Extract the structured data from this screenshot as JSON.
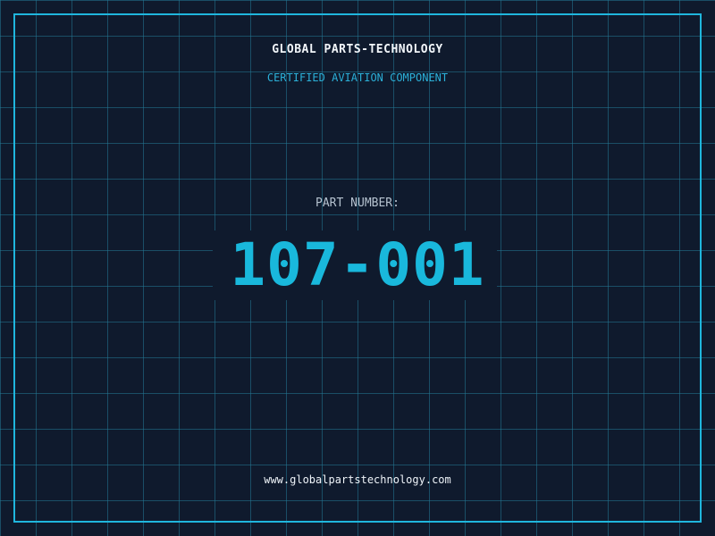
{
  "header": {
    "brand": "GLOBAL PARTS-TECHNOLOGY",
    "tagline": "CERTIFIED AVIATION COMPONENT"
  },
  "part": {
    "label": "PART NUMBER:",
    "number": "107-001"
  },
  "footer": {
    "website": "www.globalpartstechnology.com"
  },
  "colors": {
    "background": "#0f1a2d",
    "grid": "#23789a",
    "accent": "#1fb6dd",
    "text": "#f2f6fa"
  }
}
